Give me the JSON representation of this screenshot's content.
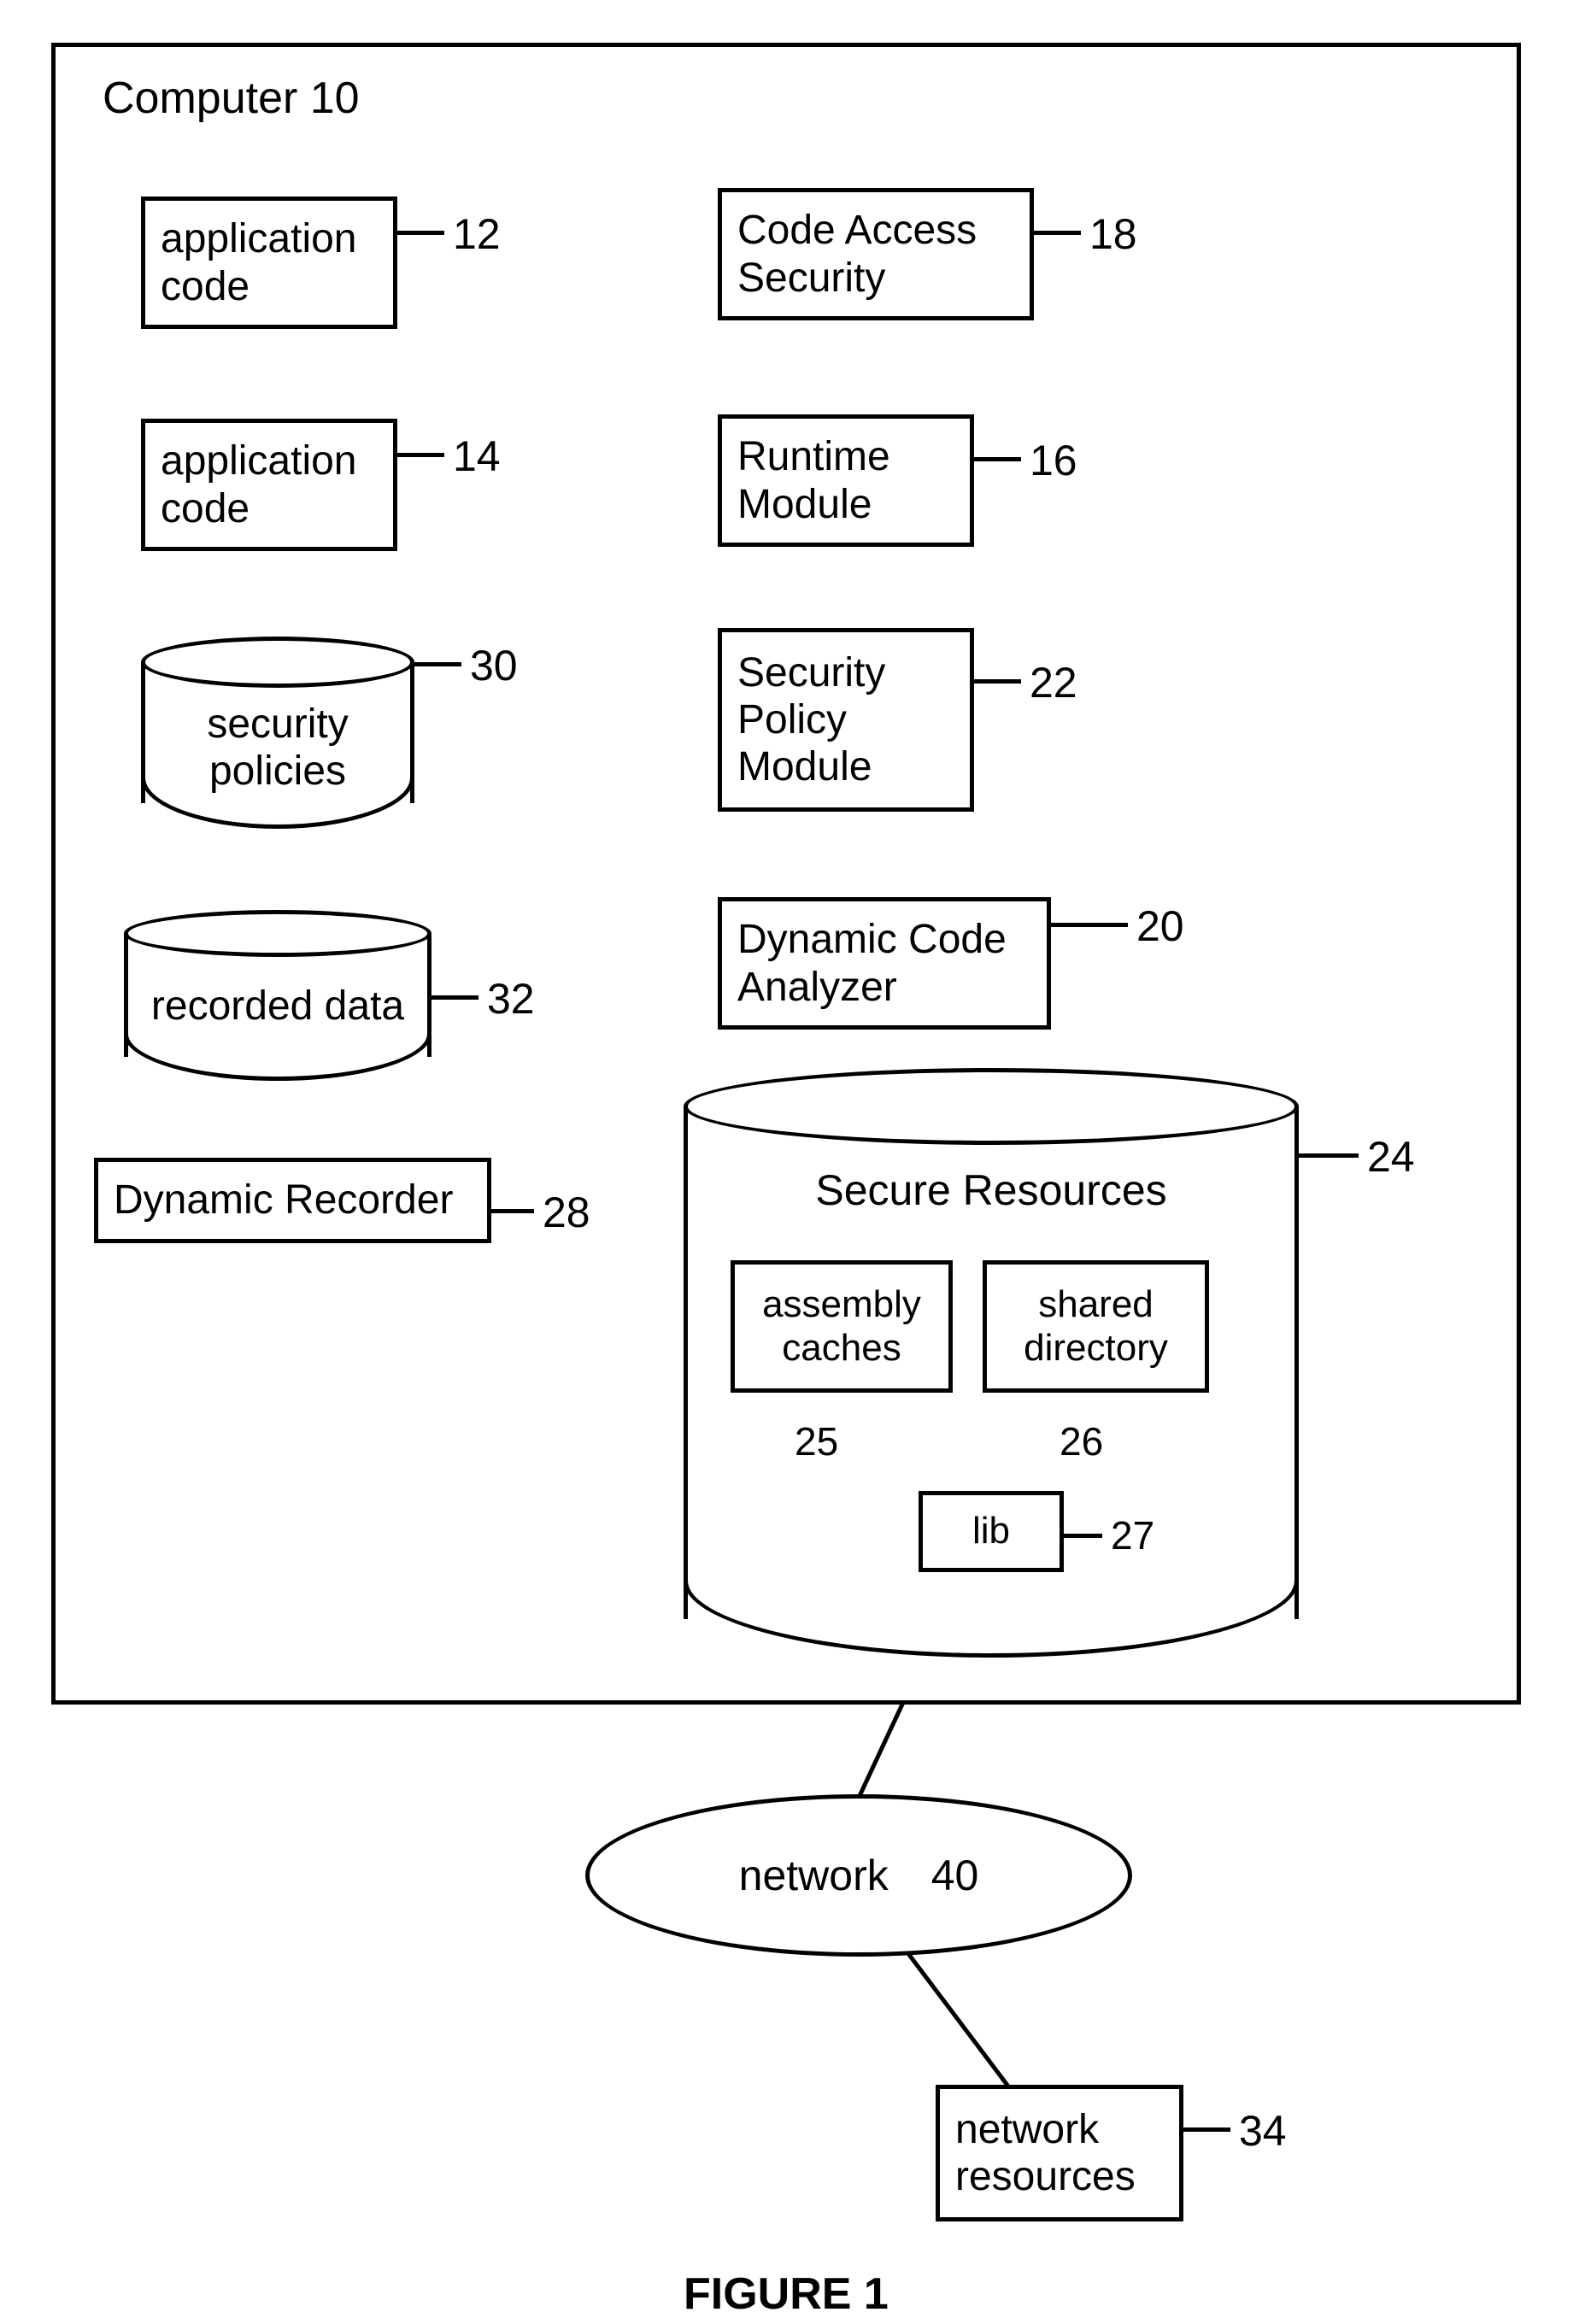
{
  "computer": {
    "title": "Computer 10"
  },
  "boxes": {
    "app_code_12": "application\ncode",
    "app_code_14": "application\ncode",
    "code_access_security": "Code Access\nSecurity",
    "runtime_module": "Runtime\nModule",
    "security_policy_module": "Security\nPolicy\nModule",
    "dynamic_code_analyzer": "Dynamic Code\nAnalyzer",
    "dynamic_recorder": "Dynamic Recorder",
    "network_resources": "network\nresources"
  },
  "cylinders": {
    "security_policies": "security\npolicies",
    "recorded_data": "recorded data",
    "secure_resources_title": "Secure Resources",
    "assembly_caches": "assembly\ncaches",
    "shared_directory": "shared\ndirectory",
    "lib": "lib"
  },
  "refs": {
    "r10": "10",
    "r12": "12",
    "r14": "14",
    "r16": "16",
    "r18": "18",
    "r20": "20",
    "r22": "22",
    "r24": "24",
    "r25": "25",
    "r26": "26",
    "r27": "27",
    "r28": "28",
    "r30": "30",
    "r32": "32",
    "r34": "34",
    "r40": "40"
  },
  "network": {
    "label": "network"
  },
  "figure_caption": "FIGURE 1"
}
